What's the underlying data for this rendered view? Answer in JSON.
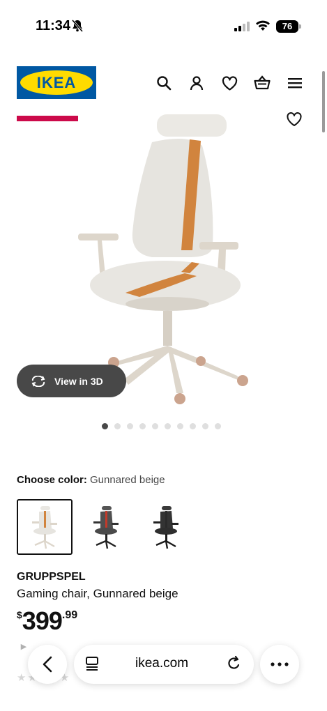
{
  "status_bar": {
    "time": "11:34",
    "battery": "76"
  },
  "header": {
    "logo_text": "IKEA",
    "icons": [
      "search-icon",
      "account-icon",
      "heart-icon",
      "basket-icon",
      "menu-icon"
    ]
  },
  "product_image": {
    "view_3d_label": "View in 3D",
    "image_count": 10,
    "active_image": 1
  },
  "color_chooser": {
    "label": "Choose color:",
    "selected_value": "Gunnared beige",
    "options": [
      "beige",
      "dark-gray-red",
      "black"
    ]
  },
  "product": {
    "name": "GRUPPSPEL",
    "description": "Gaming chair, Gunnared beige",
    "price_currency": "$",
    "price_int": "399",
    "price_dec": ".99"
  },
  "browser": {
    "url": "ikea.com"
  },
  "colors": {
    "ikea_blue": "#0058a3",
    "ikea_yellow": "#ffdb00",
    "accent_red": "#cc0a4a"
  }
}
